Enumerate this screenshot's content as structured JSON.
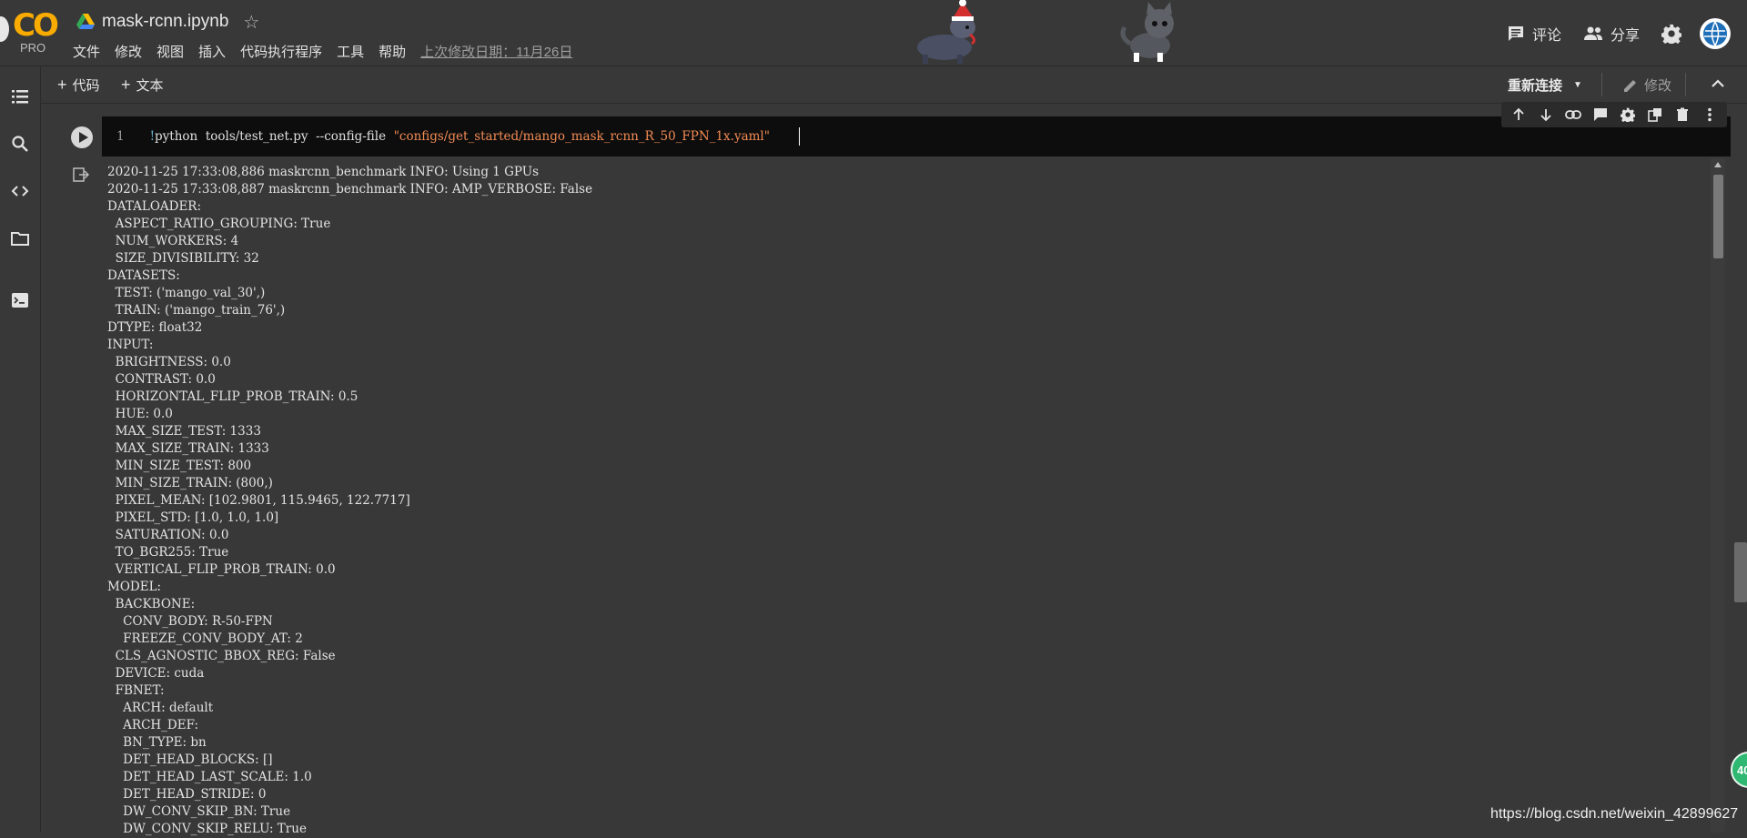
{
  "app": {
    "logo_text": "CO",
    "logo_badge": "PRO",
    "notebook_title": "mask-rcnn.ipynb"
  },
  "menu": {
    "items": [
      "文件",
      "修改",
      "视图",
      "插入",
      "代码执行程序",
      "工具",
      "帮助"
    ],
    "last_edit": "上次修改日期：11月26日"
  },
  "header_actions": {
    "comment_label": "评论",
    "share_label": "分享"
  },
  "toolbar": {
    "add_code_label": "代码",
    "add_text_label": "文本",
    "reconnect_label": "重新连接",
    "edit_label": "修改"
  },
  "cell": {
    "line_number": "1",
    "code_bang": "!",
    "code_command": "python  tools/test_net.py  --config-file  ",
    "code_string": "\"configs/get_started/mango_mask_rcnn_R_50_FPN_1x.yaml\""
  },
  "output": {
    "lines": [
      "2020-11-25 17:33:08,886 maskrcnn_benchmark INFO: Using 1 GPUs",
      "2020-11-25 17:33:08,887 maskrcnn_benchmark INFO: AMP_VERBOSE: False",
      "DATALOADER:",
      "  ASPECT_RATIO_GROUPING: True",
      "  NUM_WORKERS: 4",
      "  SIZE_DIVISIBILITY: 32",
      "DATASETS:",
      "  TEST: ('mango_val_30',)",
      "  TRAIN: ('mango_train_76',)",
      "DTYPE: float32",
      "INPUT:",
      "  BRIGHTNESS: 0.0",
      "  CONTRAST: 0.0",
      "  HORIZONTAL_FLIP_PROB_TRAIN: 0.5",
      "  HUE: 0.0",
      "  MAX_SIZE_TEST: 1333",
      "  MAX_SIZE_TRAIN: 1333",
      "  MIN_SIZE_TEST: 800",
      "  MIN_SIZE_TRAIN: (800,)",
      "  PIXEL_MEAN: [102.9801, 115.9465, 122.7717]",
      "  PIXEL_STD: [1.0, 1.0, 1.0]",
      "  SATURATION: 0.0",
      "  TO_BGR255: True",
      "  VERTICAL_FLIP_PROB_TRAIN: 0.0",
      "MODEL:",
      "  BACKBONE:",
      "    CONV_BODY: R-50-FPN",
      "    FREEZE_CONV_BODY_AT: 2",
      "  CLS_AGNOSTIC_BBOX_REG: False",
      "  DEVICE: cuda",
      "  FBNET:",
      "    ARCH: default",
      "    ARCH_DEF:",
      "    BN_TYPE: bn",
      "    DET_HEAD_BLOCKS: []",
      "    DET_HEAD_LAST_SCALE: 1.0",
      "    DET_HEAD_STRIDE: 0",
      "    DW_CONV_SKIP_BN: True",
      "    DW_CONV_SKIP_RELU: True"
    ]
  },
  "badge_text": "40",
  "watermark": "https://blog.csdn.net/weixin_42899627",
  "colors": {
    "background": "#383838",
    "code_background": "#0d0d0d",
    "logo_orange": "#f9ab00",
    "code_string": "#f28b54",
    "code_bang": "#6fb3d2",
    "badge_green": "#2eb872"
  }
}
